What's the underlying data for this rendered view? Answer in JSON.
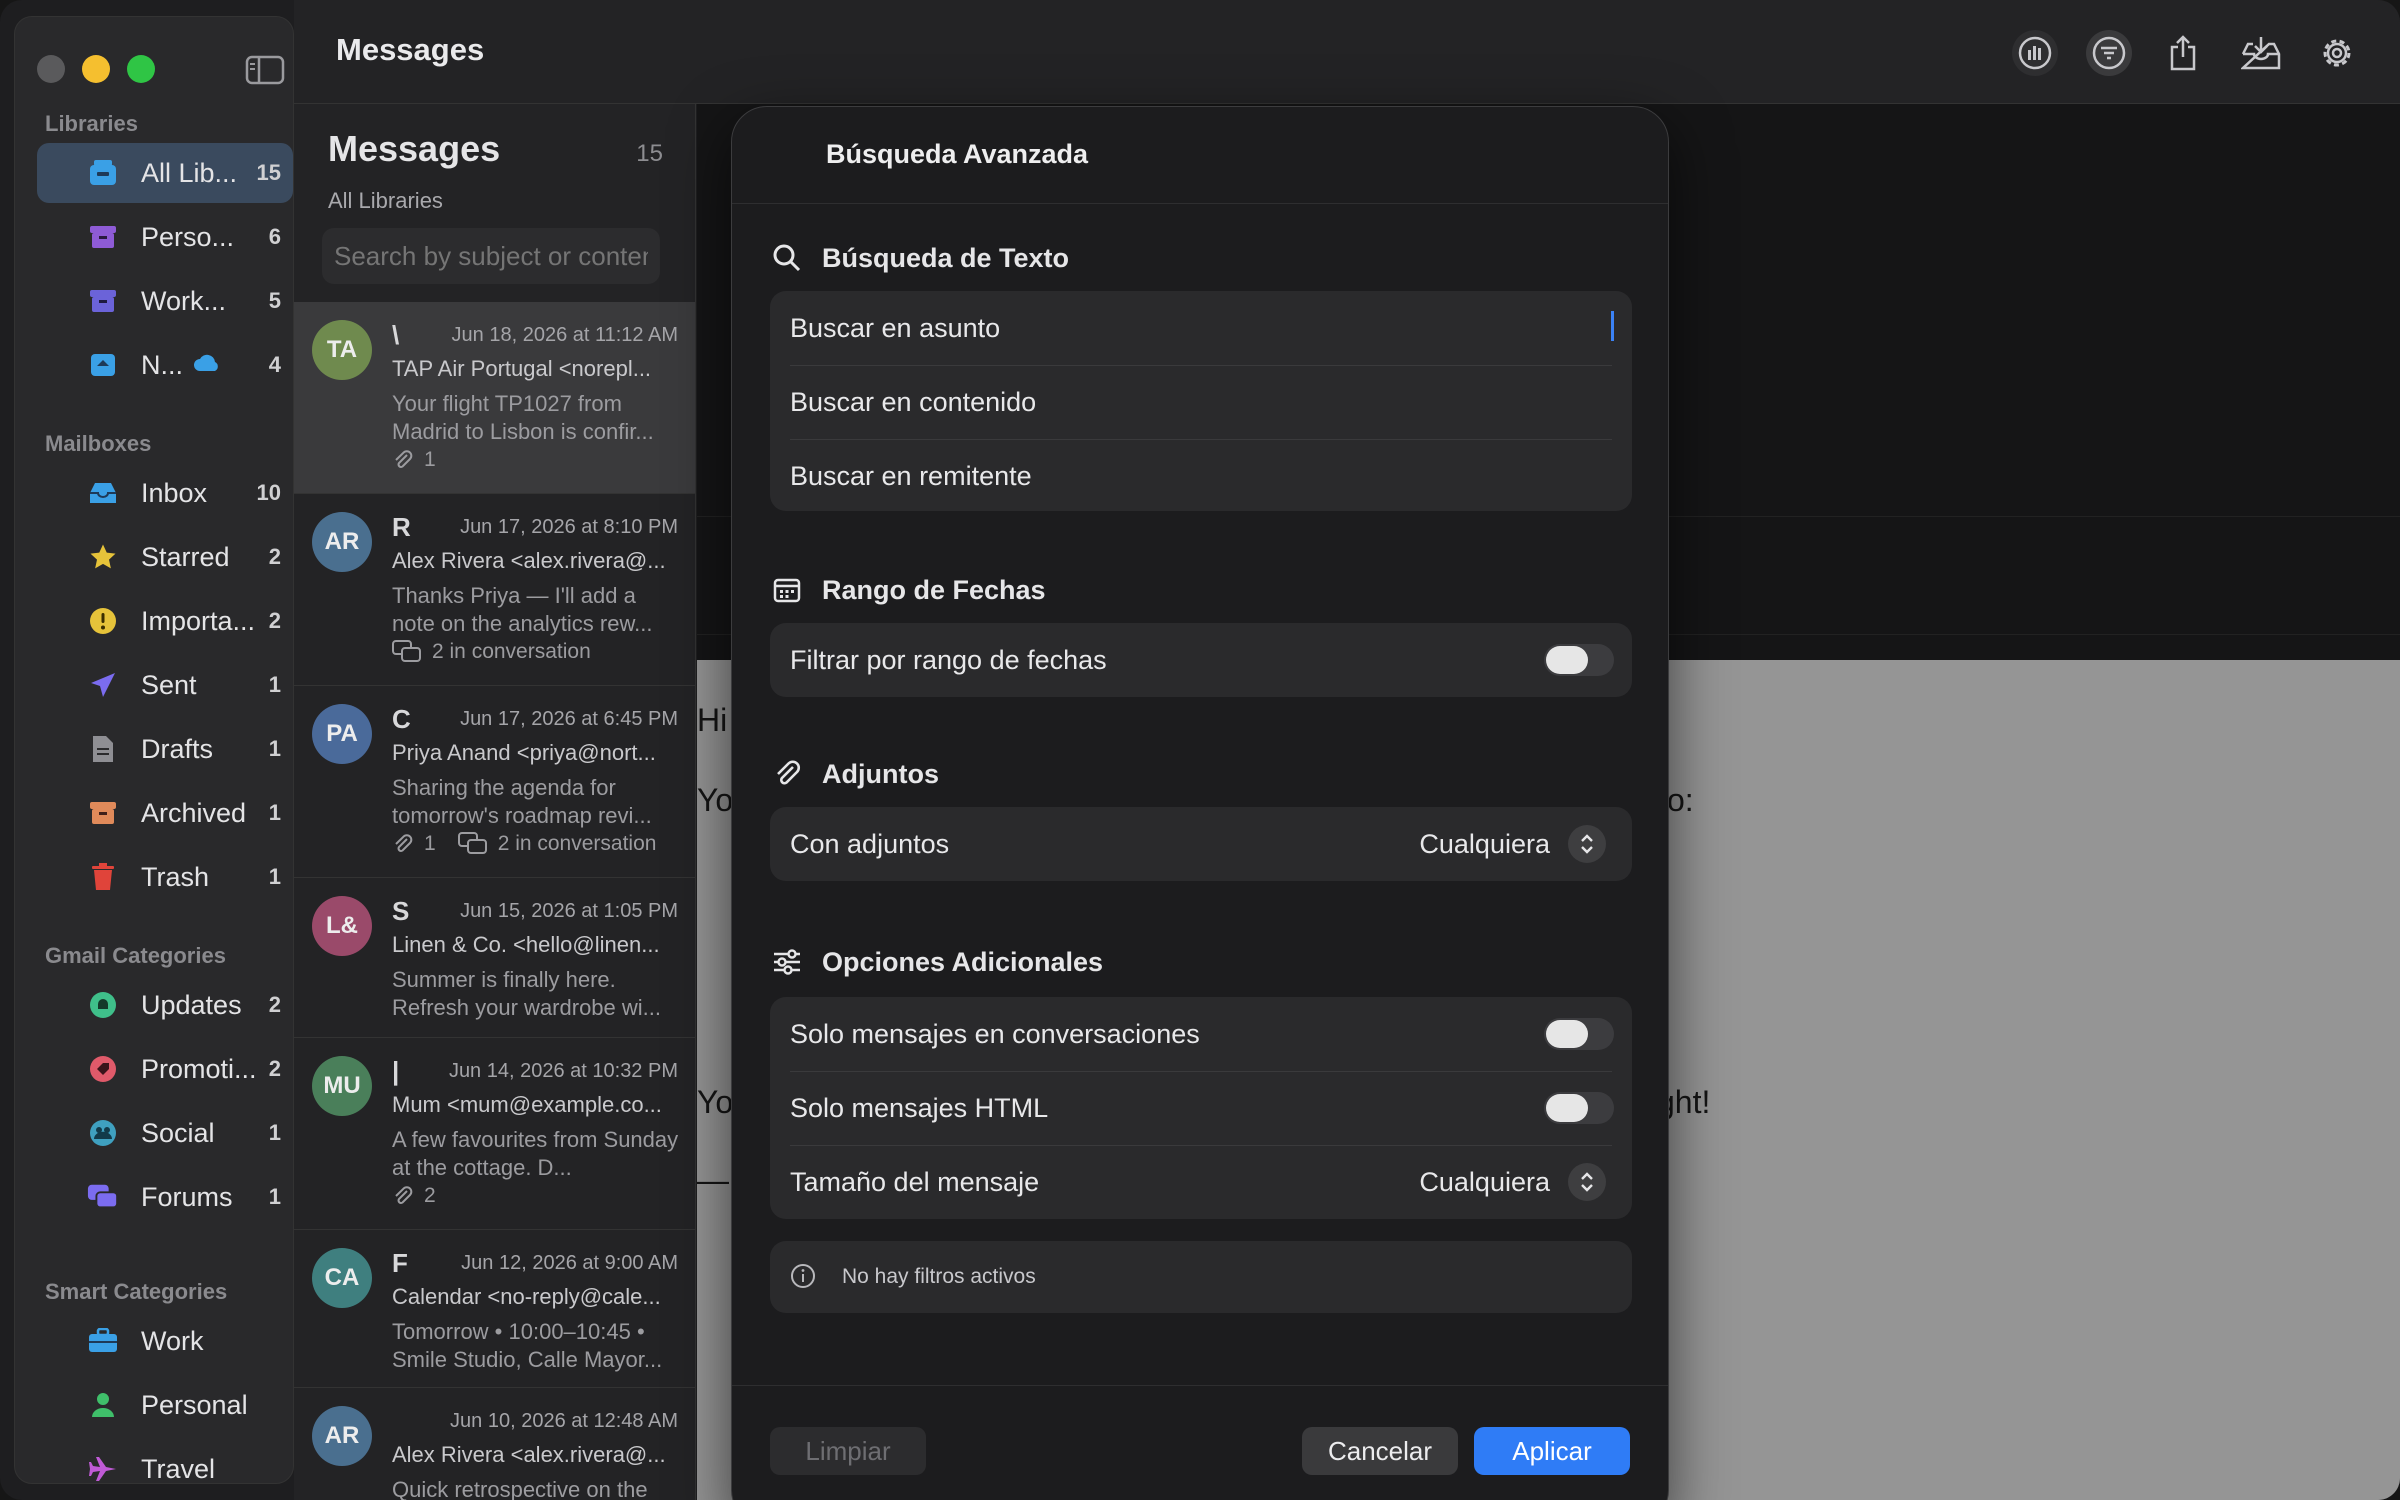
{
  "window": {
    "title": "Messages"
  },
  "sidebar": {
    "libraries_header": "Libraries",
    "libraries": [
      {
        "label": "All Lib...",
        "count": "15",
        "icon": "tray-stack-icon",
        "color": "#3aa0e6"
      },
      {
        "label": "Perso...",
        "count": "6",
        "icon": "archive-box-icon",
        "color": "#8e5bd6"
      },
      {
        "label": "Work...",
        "count": "5",
        "icon": "archive-box-icon",
        "color": "#6b63d9"
      },
      {
        "label": "N...",
        "count": "4",
        "icon": "hard-drive-icon",
        "color": "#3aa0e6",
        "cloud": "cloud-icon"
      }
    ],
    "mailboxes_header": "Mailboxes",
    "mailboxes": [
      {
        "label": "Inbox",
        "count": "10",
        "icon": "inbox-icon",
        "color": "#3aa0e6"
      },
      {
        "label": "Starred",
        "count": "2",
        "icon": "star-icon",
        "color": "#e6c33a"
      },
      {
        "label": "Importa...",
        "count": "2",
        "icon": "exclamation-icon",
        "color": "#e6c33a"
      },
      {
        "label": "Sent",
        "count": "1",
        "icon": "paper-plane-icon",
        "color": "#7b6cf0"
      },
      {
        "label": "Drafts",
        "count": "1",
        "icon": "document-icon",
        "color": "#8e8e93"
      },
      {
        "label": "Archived",
        "count": "1",
        "icon": "archive-box-icon",
        "color": "#e08a5a"
      },
      {
        "label": "Trash",
        "count": "1",
        "icon": "trash-icon",
        "color": "#e0443a"
      }
    ],
    "gmail_header": "Gmail Categories",
    "gmail": [
      {
        "label": "Updates",
        "count": "2",
        "icon": "bell-icon",
        "color": "#3fbf8a"
      },
      {
        "label": "Promoti...",
        "count": "2",
        "icon": "tag-icon",
        "color": "#e05a6a"
      },
      {
        "label": "Social",
        "count": "1",
        "icon": "people-icon",
        "color": "#3fa0c0"
      },
      {
        "label": "Forums",
        "count": "1",
        "icon": "chat-bubbles-icon",
        "color": "#7b6cf0"
      }
    ],
    "smart_header": "Smart Categories",
    "smart": [
      {
        "label": "Work",
        "icon": "briefcase-icon",
        "color": "#3aa0e6"
      },
      {
        "label": "Personal",
        "icon": "person-icon",
        "color": "#3fbf6a"
      },
      {
        "label": "Travel",
        "icon": "airplane-icon",
        "color": "#c05ad6"
      }
    ]
  },
  "list": {
    "title": "Messages",
    "count": "15",
    "subtitle": "All Libraries",
    "search_placeholder": "Search by subject or content",
    "messages": [
      {
        "initials": "TA",
        "avatar_color": "#6f8a4e",
        "sender_initial": "\\",
        "date": "Jun 18, 2026 at 11:12 AM",
        "from": "TAP Air Portugal <norepl...",
        "preview": "Your flight TP1027 from Madrid to Lisbon is confir...",
        "attachments": "1",
        "conversation": ""
      },
      {
        "initials": "AR",
        "avatar_color": "#4a6f8f",
        "sender_initial": "R",
        "date": "Jun 17, 2026 at 8:10 PM",
        "from": "Alex Rivera <alex.rivera@...",
        "preview": "Thanks Priya — I'll add a note on the analytics rew...",
        "attachments": "",
        "conversation": "2 in conversation"
      },
      {
        "initials": "PA",
        "avatar_color": "#4a6a9a",
        "sender_initial": "C",
        "date": "Jun 17, 2026 at 6:45 PM",
        "from": "Priya Anand <priya@nort...",
        "preview": "Sharing the agenda for tomorrow's roadmap revi...",
        "attachments": "1",
        "conversation": "2 in conversation"
      },
      {
        "initials": "L&",
        "avatar_color": "#9a4a6a",
        "sender_initial": "S",
        "date": "Jun 15, 2026 at 1:05 PM",
        "from": "Linen & Co. <hello@linen...",
        "preview": "Summer is finally here. Refresh your wardrobe wi...",
        "attachments": "",
        "conversation": ""
      },
      {
        "initials": "MU",
        "avatar_color": "#4a7f5a",
        "sender_initial": "|",
        "date": "Jun 14, 2026 at 10:32 PM",
        "from": "Mum <mum@example.co...",
        "preview": "A few favourites from Sunday at the cottage. D...",
        "attachments": "2",
        "conversation": ""
      },
      {
        "initials": "CA",
        "avatar_color": "#3f7f7f",
        "sender_initial": "F",
        "date": "Jun 12, 2026 at 9:00 AM",
        "from": "Calendar <no-reply@cale...",
        "preview": "Tomorrow • 10:00–10:45 • Smile Studio, Calle Mayor...",
        "attachments": "",
        "conversation": ""
      },
      {
        "initials": "AR",
        "avatar_color": "#4a6f8f",
        "sender_initial": "",
        "date": "Jun 10, 2026 at 12:48 AM",
        "from": "Alex Rivera <alex.rivera@...",
        "preview": "Quick retrospective on the",
        "attachments": "",
        "conversation": ""
      }
    ]
  },
  "detail": {
    "fragment_hi": "Hi",
    "fragment_yo1": "Yo",
    "fragment_yo2": "Yo",
    "fragment_dash": "—",
    "fragment_colon": "o:",
    "fragment_ght": "ght!"
  },
  "modal": {
    "title": "Búsqueda Avanzada",
    "text_section": {
      "title": "Búsqueda de Texto",
      "fields": [
        "Buscar en asunto",
        "Buscar en contenido",
        "Buscar en remitente"
      ]
    },
    "date_section": {
      "title": "Rango de Fechas",
      "filter_label": "Filtrar por rango de fechas",
      "filter_on": false
    },
    "attach_section": {
      "title": "Adjuntos",
      "label": "Con adjuntos",
      "value": "Cualquiera"
    },
    "extra_section": {
      "title": "Opciones Adicionales",
      "conv_label": "Solo mensajes en conversaciones",
      "conv_on": false,
      "html_label": "Solo mensajes HTML",
      "html_on": false,
      "size_label": "Tamaño del mensaje",
      "size_value": "Cualquiera"
    },
    "info": "No hay filtros activos",
    "buttons": {
      "clear": "Limpiar",
      "cancel": "Cancelar",
      "apply": "Aplicar"
    },
    "accent": "#2f7cf6"
  }
}
